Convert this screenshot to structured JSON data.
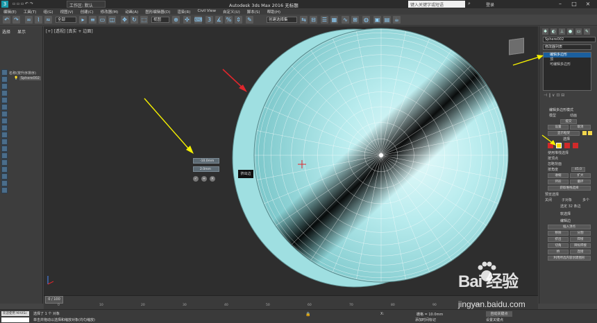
{
  "titlebar": {
    "workspace": "工作区: 默认",
    "title": "Autodesk 3ds Max 2016    无标题",
    "search_placeholder": "键入关键字或短语",
    "login": "登录"
  },
  "menubar": [
    "编辑(E)",
    "工具(T)",
    "组(G)",
    "视图(V)",
    "创建(C)",
    "修改器(M)",
    "动画(A)",
    "图形编辑器(D)",
    "渲染(R)",
    "Civil View",
    "自定义(U)",
    "脚本(S)",
    "帮助(H)"
  ],
  "toolbar": {
    "filter": "全部",
    "coord": "视图",
    "selset": "创建选择集"
  },
  "scene_explorer": {
    "tabs": [
      "选择",
      "显示"
    ],
    "root": "名称(按升序排序)",
    "item": "Sphere002"
  },
  "viewport": {
    "label": "[+] [透视] [真实 + 边面]"
  },
  "caddy": {
    "title": "挤出边",
    "height": "-10.0mm",
    "width": "2.0mm"
  },
  "command_panel": {
    "object_name": "Sphere002",
    "modifier_list": "修改器列表",
    "stack": [
      "编辑多边形",
      "顶",
      "可编辑多边形"
    ],
    "rollouts": {
      "edit_poly_mode": "编辑多边形模式",
      "model": "模型",
      "animate": "动画",
      "commit": "提交",
      "settings": "设置",
      "cancel": "取消",
      "show_cage": "显示框架",
      "selection": "选择",
      "use_stack": "使用堆栈选择",
      "by_vertex": "按顶点",
      "ignore_back": "忽略背面",
      "by_angle": "按角度",
      "angle_value": "45.0",
      "shrink": "收缩",
      "grow": "扩大",
      "ring": "环形",
      "loop": "循环",
      "get_stack": "获取堆栈选择",
      "preview": "预览选择",
      "off": "关闭",
      "subobj": "子对象",
      "multi": "多个",
      "selected": "选定 32 条边",
      "soft_sel": "软选择",
      "edit_edges": "编辑边",
      "insert_vertex": "插入顶点",
      "remove": "移除",
      "split": "分割",
      "extrude": "挤出",
      "weld": "焊接",
      "chamfer": "切角",
      "target_weld": "目标焊接",
      "bridge": "桥",
      "connect": "连接",
      "create_shape": "利用所选内容创建图形"
    }
  },
  "timeline": {
    "frame": "0 / 100",
    "ticks": [
      "0",
      "10",
      "20",
      "30",
      "40",
      "50",
      "60",
      "70",
      "80",
      "90",
      "100"
    ]
  },
  "status": {
    "welcome": "欢迎使用 MAXSc",
    "line1": "选择了 1 个 对象",
    "line2": "单击并拖动以选择和缩放对象(均匀缩放)",
    "x": "X:",
    "grid": "栅格 = 10.0mm",
    "addtime": "添加时间标记",
    "autokey": "自动关键点",
    "setkey": "设置关键点"
  },
  "watermark": {
    "brand": "Bai 经验",
    "url": "jingyan.baidu.com"
  },
  "colors": {
    "sphere": "#a8e8ea",
    "selection": "#1b5f9e",
    "arrow_yellow": "#f5f000",
    "arrow_red": "#e0262c"
  }
}
